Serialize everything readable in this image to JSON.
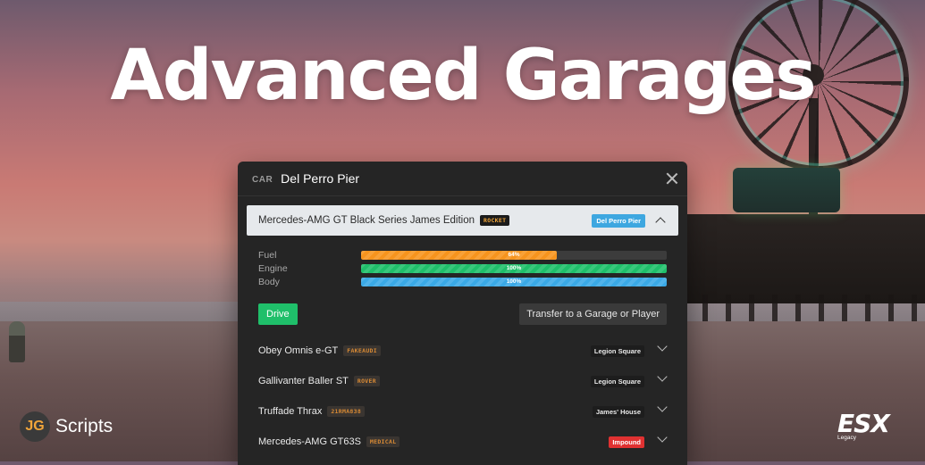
{
  "hero": {
    "title": "Advanced Garages"
  },
  "garage": {
    "type_label": "CAR",
    "name": "Del Perro Pier"
  },
  "selected_vehicle": {
    "name": "Mercedes-AMG GT Black Series James Edition",
    "plate": "ROCKET",
    "location": "Del Perro Pier",
    "stats": [
      {
        "label": "Fuel",
        "value": 64,
        "text": "64%",
        "color": "#f7941d"
      },
      {
        "label": "Engine",
        "value": 100,
        "text": "100%",
        "color": "#1fbf6a"
      },
      {
        "label": "Body",
        "value": 100,
        "text": "100%",
        "color": "#3aa9e6"
      }
    ],
    "drive_label": "Drive",
    "transfer_label": "Transfer to a Garage or Player"
  },
  "vehicles": [
    {
      "name": "Obey Omnis e-GT",
      "plate": "FAKEAUDI",
      "location": "Legion Square",
      "status": "normal"
    },
    {
      "name": "Gallivanter Baller ST",
      "plate": "ROVER",
      "location": "Legion Square",
      "status": "normal"
    },
    {
      "name": "Truffade Thrax",
      "plate": "21RMA838",
      "location": "James' House",
      "status": "normal"
    },
    {
      "name": "Mercedes-AMG GT63S",
      "plate": "MEDICAL",
      "location": "Impound",
      "status": "impound"
    }
  ],
  "branding": {
    "jg_initials": "JG",
    "jg_text": "Scripts",
    "esx_main": "ESX",
    "esx_sub": "Legacy"
  }
}
